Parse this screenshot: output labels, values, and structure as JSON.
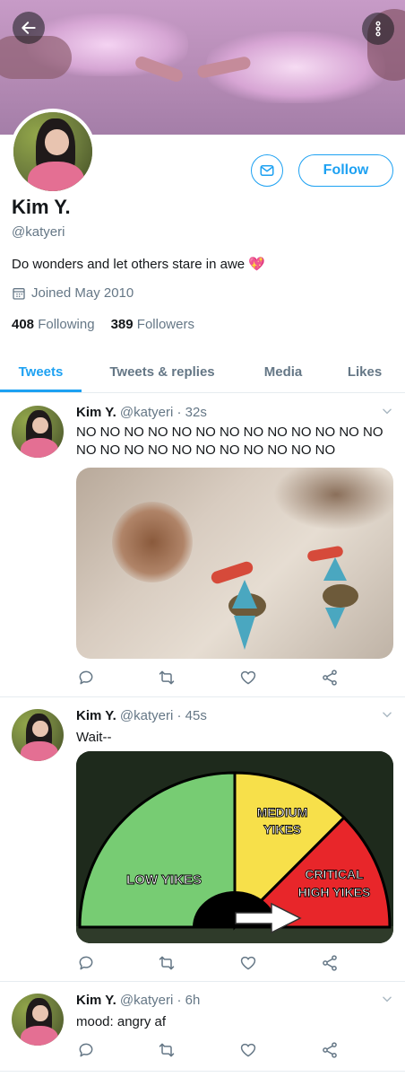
{
  "colors": {
    "accent": "#1da1f2",
    "text": "#14171a",
    "muted": "#657786",
    "border": "#e6ecf0"
  },
  "banner": {
    "back_icon": "arrow-left-icon",
    "more_icon": "more-vertical-icon"
  },
  "profile": {
    "name": "Kim Y.",
    "handle": "@katyeri",
    "bio": "Do wonders and let others stare in awe",
    "bio_emoji": "💖",
    "joined": "Joined May 2010",
    "following_count": "408",
    "following_label": "Following",
    "followers_count": "389",
    "followers_label": "Followers",
    "follow_label": "Follow"
  },
  "tabs": [
    {
      "label": "Tweets"
    },
    {
      "label": "Tweets & replies"
    },
    {
      "label": "Media"
    },
    {
      "label": "Likes"
    }
  ],
  "tweets": [
    {
      "name": "Kim Y.",
      "meta": "@katyeri · 32s",
      "text": "NO NO NO NO NO NO NO NO NO NO NO NO NO NO NO NO NO NO NO NO NO NO NO NO"
    },
    {
      "name": "Kim Y.",
      "meta": "@katyeri · 45s",
      "text": "Wait--",
      "meter": {
        "low": "LOW YIKES",
        "medium_1": "MEDIUM",
        "medium_2": "YIKES",
        "critical_1": "CRITICAL",
        "critical_2": "HIGH YIKES"
      }
    },
    {
      "name": "Kim Y.",
      "meta": "@katyeri · 6h",
      "text": "mood: angry af"
    }
  ]
}
